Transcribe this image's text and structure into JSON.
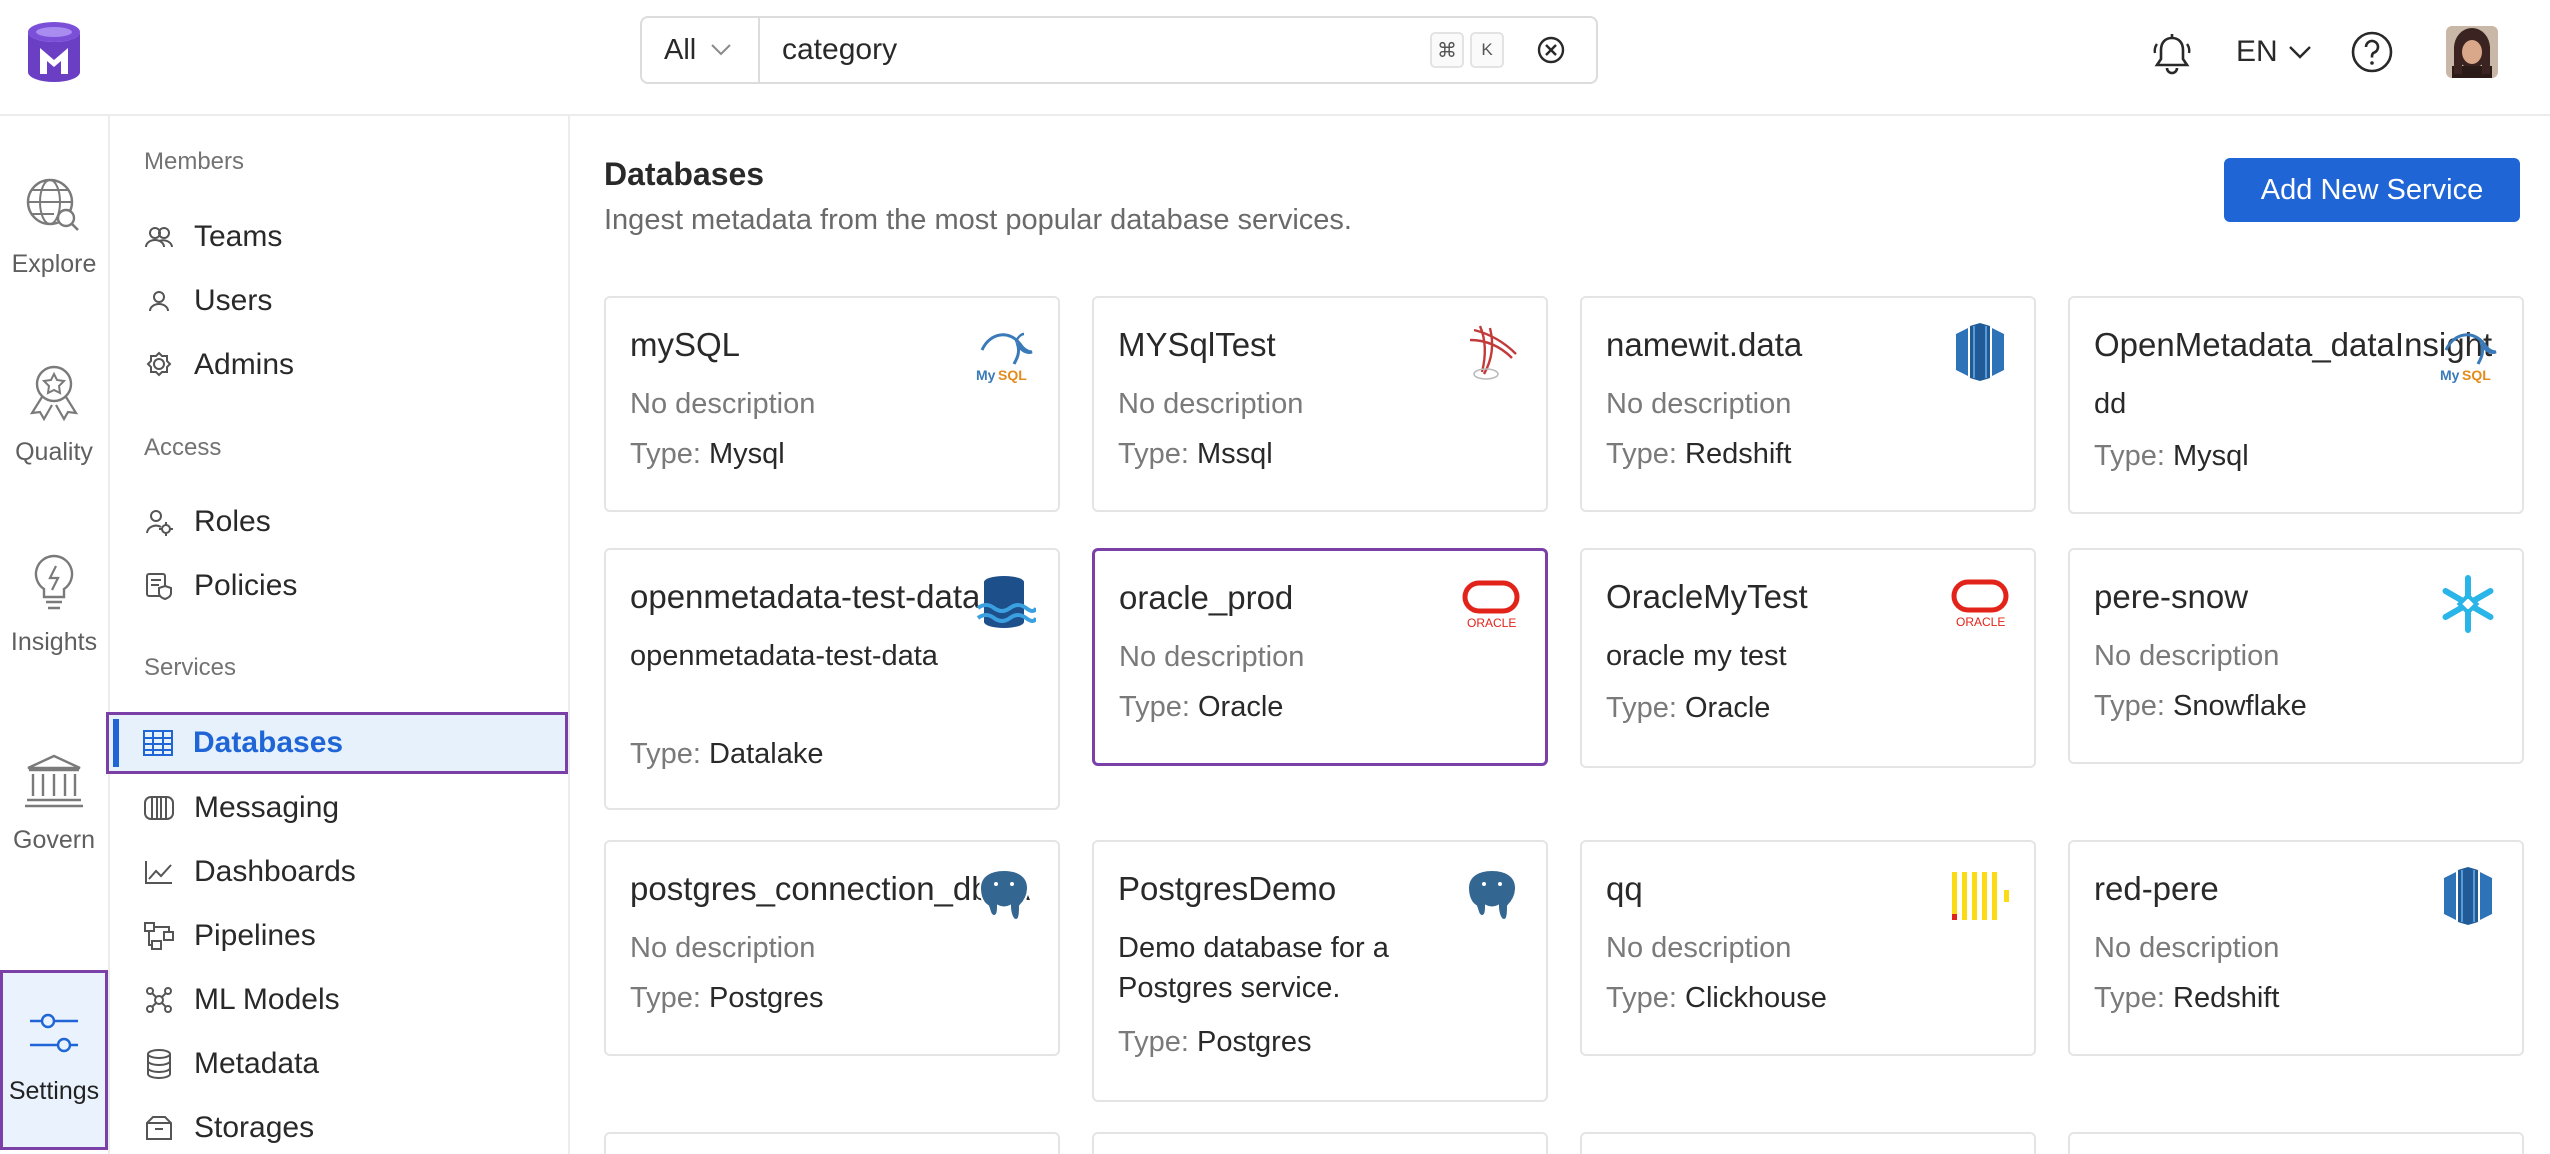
{
  "app": {
    "name": "OpenMetadata"
  },
  "search": {
    "scope": "All",
    "value": "category",
    "shortcut_cmd": "⌘",
    "shortcut_key": "K"
  },
  "header": {
    "language": "EN"
  },
  "rail": [
    {
      "label": "Explore"
    },
    {
      "label": "Quality"
    },
    {
      "label": "Insights"
    },
    {
      "label": "Govern"
    },
    {
      "label": "Settings"
    }
  ],
  "nav": {
    "members_title": "Members",
    "teams": "Teams",
    "users": "Users",
    "admins": "Admins",
    "access_title": "Access",
    "roles": "Roles",
    "policies": "Policies",
    "services_title": "Services",
    "databases": "Databases",
    "messaging": "Messaging",
    "dashboards": "Dashboards",
    "pipelines": "Pipelines",
    "ml_models": "ML Models",
    "metadata": "Metadata",
    "storages": "Storages"
  },
  "main": {
    "title": "Databases",
    "subtitle": "Ingest metadata from the most popular database services.",
    "add_button": "Add New Service",
    "type_label": "Type:",
    "cards": [
      {
        "name": "mySQL",
        "description": "No description",
        "type": "Mysql",
        "logo": "mysql-icon"
      },
      {
        "name": "MYSqlTest",
        "description": "No description",
        "type": "Mssql",
        "logo": "mssql-icon"
      },
      {
        "name": "namewit.data",
        "description": "No description",
        "type": "Redshift",
        "logo": "redshift-icon"
      },
      {
        "name": "OpenMetadata_dataInsight",
        "description": "dd",
        "type": "Mysql",
        "logo": "mysql-icon"
      },
      {
        "name": "openmetadata-test-data",
        "description": "openmetadata-test-data",
        "type": "Datalake",
        "logo": "datalake-icon"
      },
      {
        "name": "oracle_prod",
        "description": "No description",
        "type": "Oracle",
        "logo": "oracle-icon"
      },
      {
        "name": "OracleMyTest",
        "description": "oracle my test",
        "type": "Oracle",
        "logo": "oracle-icon"
      },
      {
        "name": "pere-snow",
        "description": "No description",
        "type": "Snowflake",
        "logo": "snowflake-icon"
      },
      {
        "name": "postgres_connection_db_A",
        "description": "No description",
        "type": "Postgres",
        "logo": "postgres-icon"
      },
      {
        "name": "PostgresDemo",
        "description": "Demo database for a Postgres service.",
        "type": "Postgres",
        "logo": "postgres-icon"
      },
      {
        "name": "qq",
        "description": "No description",
        "type": "Clickhouse",
        "logo": "clickhouse-icon"
      },
      {
        "name": "red-pere",
        "description": "No description",
        "type": "Redshift",
        "logo": "redshift-icon"
      }
    ]
  }
}
